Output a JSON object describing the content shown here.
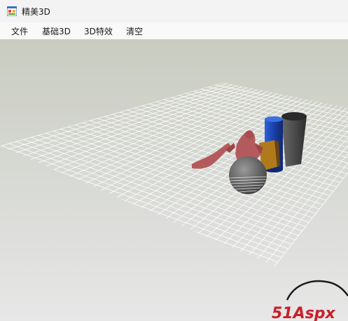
{
  "window": {
    "title": "精美3D",
    "icon": "app-window-icon"
  },
  "menu": {
    "items": [
      "文件",
      "基础3D",
      "3D特效",
      "清空"
    ]
  },
  "watermark": {
    "text": "51Aspx"
  },
  "colors": {
    "grid_line": "#ffffff",
    "figure": "#b55a5c",
    "cylinder_blue": "#1d4fc2",
    "cylinder_gray": "#4a4a4a",
    "box_brown": "#b07a1c",
    "sphere": "#5b5b5b",
    "watermark_red": "#c8202a"
  }
}
